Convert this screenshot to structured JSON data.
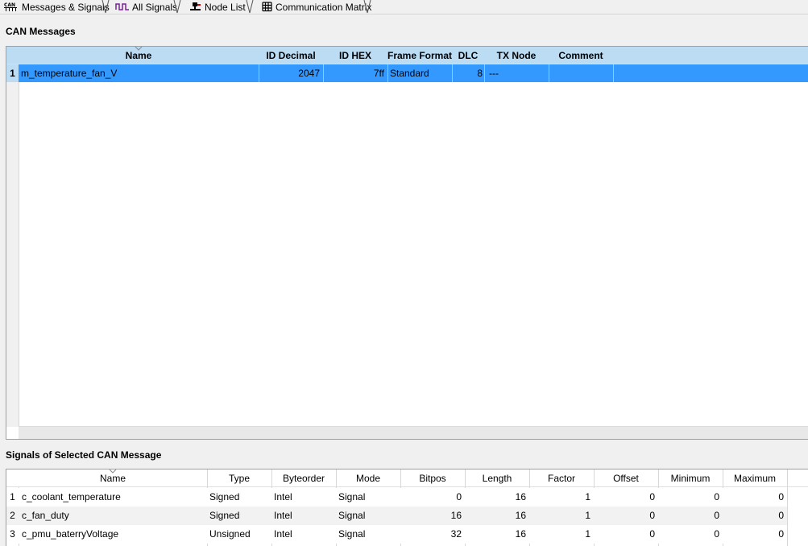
{
  "tabs": [
    {
      "label": "Messages & Signals",
      "icon": "can-bus-icon",
      "active": true
    },
    {
      "label": "All Signals",
      "icon": "signal-wave-icon",
      "active": false
    },
    {
      "label": "Node List",
      "icon": "node-network-icon",
      "active": false
    },
    {
      "label": "Communication Matrix",
      "icon": "grid-matrix-icon",
      "active": false
    }
  ],
  "messages": {
    "title": "CAN Messages",
    "columns": [
      "Name",
      "ID Decimal",
      "ID HEX",
      "Frame Format",
      "DLC",
      "TX Node",
      "Comment"
    ],
    "rows": [
      {
        "num": "1",
        "name": "m_temperature_fan_V",
        "id_decimal": "2047",
        "id_hex": "7ff",
        "frame_format": "Standard",
        "dlc": "8",
        "tx_node": "---",
        "comment": ""
      }
    ]
  },
  "signals": {
    "title": "Signals of Selected CAN Message",
    "columns": [
      "Name",
      "Type",
      "Byteorder",
      "Mode",
      "Bitpos",
      "Length",
      "Factor",
      "Offset",
      "Minimum",
      "Maximum"
    ],
    "rows": [
      {
        "num": "1",
        "name": "c_coolant_temperature",
        "type": "Signed",
        "byteorder": "Intel",
        "mode": "Signal",
        "bitpos": "0",
        "length": "16",
        "factor": "1",
        "offset": "0",
        "minimum": "0",
        "maximum": "0"
      },
      {
        "num": "2",
        "name": "c_fan_duty",
        "type": "Signed",
        "byteorder": "Intel",
        "mode": "Signal",
        "bitpos": "16",
        "length": "16",
        "factor": "1",
        "offset": "0",
        "minimum": "0",
        "maximum": "0"
      },
      {
        "num": "3",
        "name": "c_pmu_baterryVoltage",
        "type": "Unsigned",
        "byteorder": "Intel",
        "mode": "Signal",
        "bitpos": "32",
        "length": "16",
        "factor": "1",
        "offset": "0",
        "minimum": "0",
        "maximum": "0"
      }
    ]
  },
  "colors": {
    "selection": "#3399ff",
    "header_bar": "#bcdcf4",
    "grid_line": "#d8d8d8"
  }
}
